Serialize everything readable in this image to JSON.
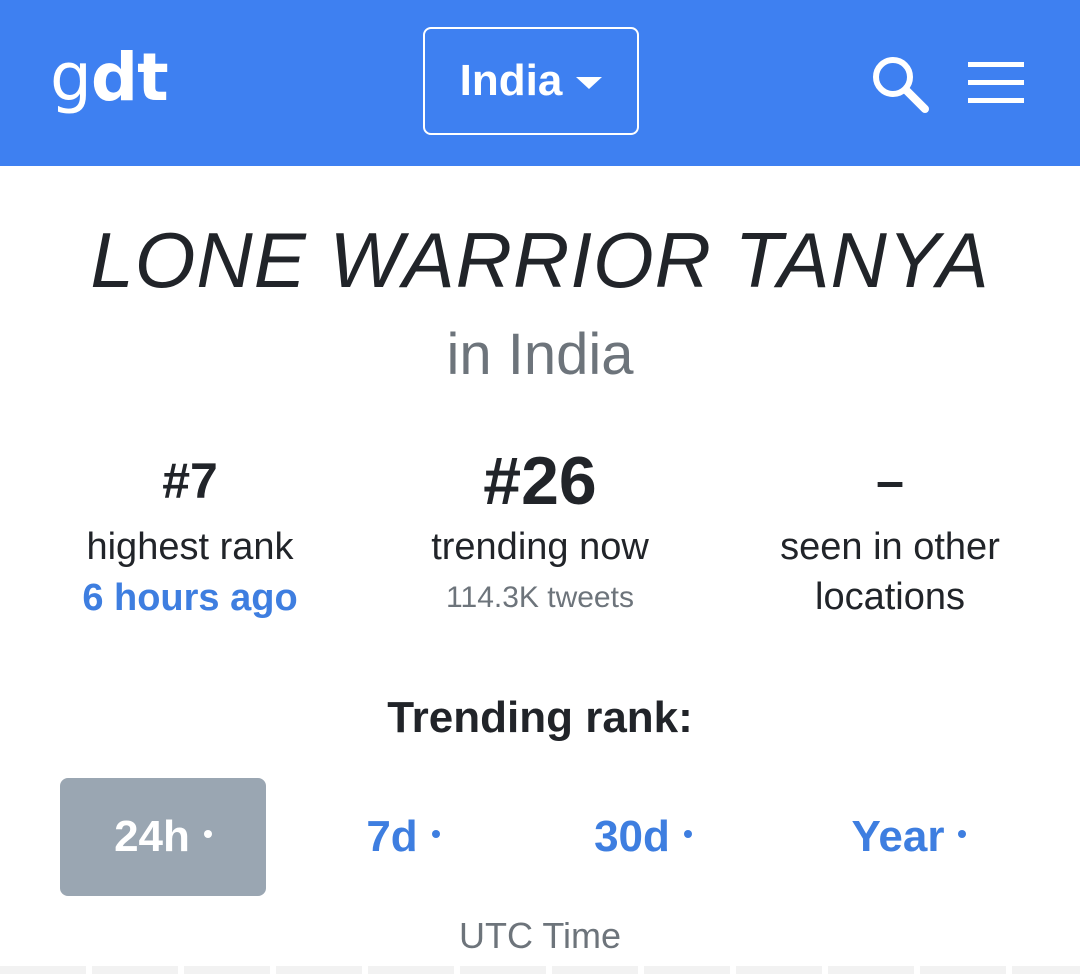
{
  "header": {
    "logo_g": "g",
    "logo_dt": "dt",
    "country": "India",
    "colors": {
      "background": "#3e80f1",
      "foreground": "#ffffff"
    },
    "icons": {
      "country": "chevron-down-icon",
      "search": "search-icon",
      "menu": "hamburger-menu-icon"
    }
  },
  "topic": {
    "title": "LONE WARRIOR TANYA",
    "location": "in India"
  },
  "stats": {
    "highest": {
      "value": "#7",
      "label": "highest rank",
      "when": "6 hours ago"
    },
    "now": {
      "value": "#26",
      "label": "trending now",
      "tweets": "114.3K tweets"
    },
    "other": {
      "value": "–",
      "label_line1": "seen in other",
      "label_line2": "locations"
    }
  },
  "trending": {
    "title": "Trending rank:",
    "tabs": [
      {
        "label": "24h",
        "selected": true
      },
      {
        "label": "7d",
        "selected": false
      },
      {
        "label": "30d",
        "selected": false
      },
      {
        "label": "Year",
        "selected": false
      }
    ],
    "time_note": "UTC Time"
  },
  "colors": {
    "link": "#3e7ee0",
    "text": "#212429",
    "muted": "#6d747b",
    "selected_tab": "#9aa6b2"
  }
}
